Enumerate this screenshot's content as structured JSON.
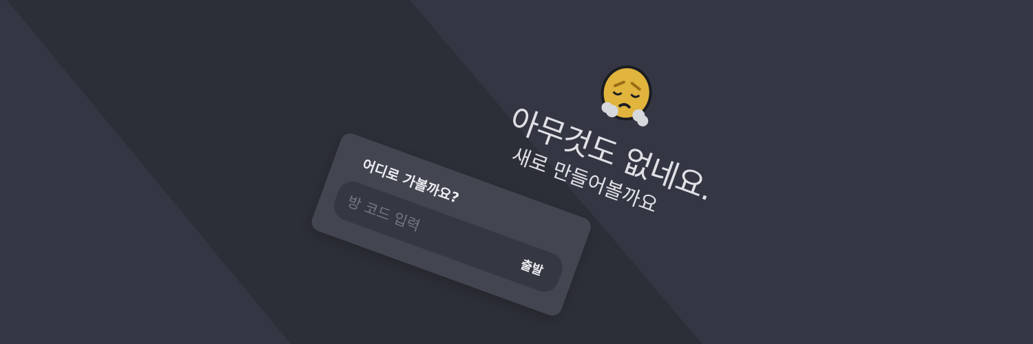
{
  "empty_state": {
    "title": "아무것도 없네요.",
    "subtitle": "새로 만들어볼까요",
    "emoji_icon": "face-with-steam-icon"
  },
  "join_card": {
    "title": "어디로 가볼까요?",
    "input_value": "",
    "input_placeholder": "방 코드 입력",
    "submit_label": "출발"
  },
  "colors": {
    "background": "#2d2f38",
    "background_panel": "#343743",
    "card": "#434651",
    "input": "#353842",
    "text": "#eceef2",
    "placeholder": "#737784",
    "emoji_yellow": "#e0b43d"
  }
}
